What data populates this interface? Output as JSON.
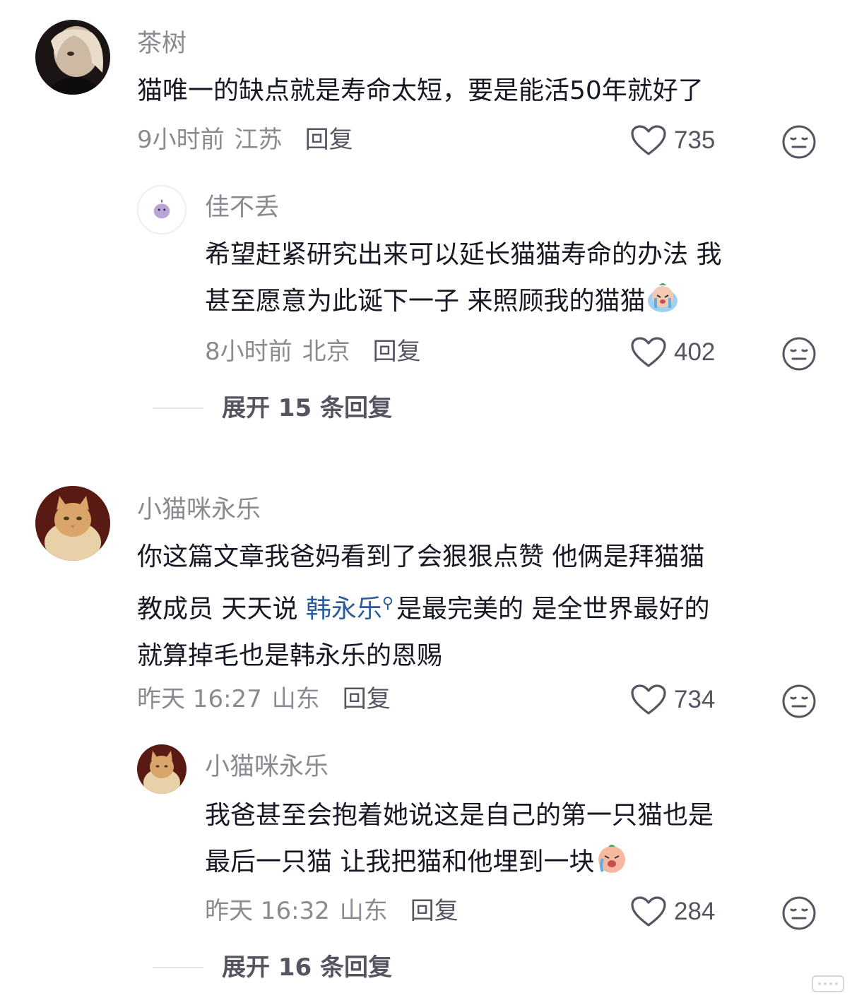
{
  "comments": [
    {
      "username": "茶树",
      "text": "猫唯一的缺点就是寿命太短，要是能活50年就好了",
      "time": "9小时前",
      "location": "江苏",
      "reply_label": "回复",
      "likes": "735",
      "reply": {
        "username": "佳不丢",
        "text_line1": "希望赶紧研究出来可以延长猫猫寿命的办法 我",
        "text_line2": "甚至愿意为此诞下一子 来照顾我的猫猫",
        "time": "8小时前",
        "location": "北京",
        "reply_label": "回复",
        "likes": "402"
      },
      "expand_label": "展开 15 条回复"
    },
    {
      "username": "小猫咪永乐",
      "text_line1": "你这篇文章我爸妈看到了会狠狠点赞 他俩是拜猫猫",
      "text_line2_a": "教成员 天天说 ",
      "mention": "韩永乐",
      "text_line2_b": "是最完美的 是全世界最好的",
      "text_line3": "就算掉毛也是韩永乐的恩赐",
      "time": "昨天 16:27",
      "location": "山东",
      "reply_label": "回复",
      "likes": "734",
      "reply": {
        "username": "小猫咪永乐",
        "text_line1": "我爸甚至会抱着她说这是自己的第一只猫也是",
        "text_line2": "最后一只猫 让我把猫和他埋到一块",
        "time": "昨天 16:32",
        "location": "山东",
        "reply_label": "回复",
        "likes": "284"
      },
      "expand_label": "展开 16 条回复"
    }
  ],
  "icons": {
    "like": "heart-outline-icon",
    "dislike": "meh-face-icon",
    "mention": "search-icon"
  },
  "colors": {
    "text_primary": "#161823",
    "text_secondary": "#8a8b91",
    "reply_link": "#545560",
    "mention": "#2b5b9a"
  }
}
